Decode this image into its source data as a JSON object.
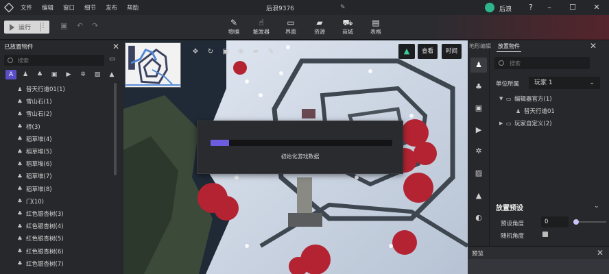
{
  "titlebar": {
    "menus": [
      "文件",
      "编辑",
      "窗口",
      "细节",
      "发布",
      "帮助"
    ],
    "doc_title": "后浪9376",
    "user_name": "后浪",
    "edit_icon": "pencil-icon",
    "help_icon": "question-icon"
  },
  "toolbar": {
    "run_label": "运行",
    "tools": [
      {
        "label": "物编",
        "icon": "edit-icon"
      },
      {
        "label": "触发器",
        "icon": "hand-pointer-icon"
      },
      {
        "label": "界面",
        "icon": "monitor-icon"
      },
      {
        "label": "资源",
        "icon": "folder-icon"
      },
      {
        "label": "商城",
        "icon": "cart-icon"
      },
      {
        "label": "表格",
        "icon": "table-icon"
      }
    ],
    "accent": "#7a2030"
  },
  "left_panel": {
    "title": "已放置物件",
    "search_placeholder": "搜索",
    "filters": [
      "A",
      "person-icon",
      "tree-icon",
      "building-icon",
      "camera-icon",
      "sparkle-icon",
      "stripes-icon",
      "mountain-icon",
      "sound-icon"
    ],
    "items": [
      {
        "label": "替天行道01(1)",
        "icon": "person-icon"
      },
      {
        "label": "雪山石(1)",
        "icon": "tree-icon"
      },
      {
        "label": "雪山石(2)",
        "icon": "tree-icon"
      },
      {
        "label": "桥(3)",
        "icon": "tree-icon"
      },
      {
        "label": "稻草堆(4)",
        "icon": "tree-icon"
      },
      {
        "label": "稻草堆(5)",
        "icon": "tree-icon"
      },
      {
        "label": "稻草堆(6)",
        "icon": "tree-icon"
      },
      {
        "label": "稻草堆(7)",
        "icon": "tree-icon"
      },
      {
        "label": "稻草堆(8)",
        "icon": "tree-icon"
      },
      {
        "label": "门(10)",
        "icon": "tree-icon"
      },
      {
        "label": "红色银杏树(3)",
        "icon": "tree-icon"
      },
      {
        "label": "红色银杏树(4)",
        "icon": "tree-icon"
      },
      {
        "label": "红色银杏树(5)",
        "icon": "tree-icon"
      },
      {
        "label": "红色银杏树(6)",
        "icon": "tree-icon"
      },
      {
        "label": "红色银杏树(7)",
        "icon": "tree-icon"
      }
    ]
  },
  "viewport": {
    "view_button": "查看",
    "time_button": "时间",
    "tool_icons": [
      "move-icon",
      "rotate-icon",
      "scale-icon",
      "target-icon",
      "align-icon",
      "measure-icon"
    ]
  },
  "loading": {
    "text": "初始化游戏数据",
    "progress": 0.1,
    "color": "#6c5ce0"
  },
  "right_panel": {
    "tabs": [
      "地形编辑",
      "放置物件"
    ],
    "active_tab": 1,
    "search_placeholder": "搜索",
    "owner_label": "单位所属",
    "owner_value": "玩家 1",
    "tree": [
      {
        "label": "编辑器官方(1)",
        "expanded": true,
        "depth": 0
      },
      {
        "label": "替天行道01",
        "expanded": false,
        "depth": 1
      },
      {
        "label": "玩家自定义(2)",
        "expanded": false,
        "depth": 0
      }
    ],
    "section_title": "放置预设",
    "angle_label": "预设角度",
    "angle_value": "0",
    "random_label": "随机角度"
  },
  "preview": {
    "title": "预览"
  }
}
